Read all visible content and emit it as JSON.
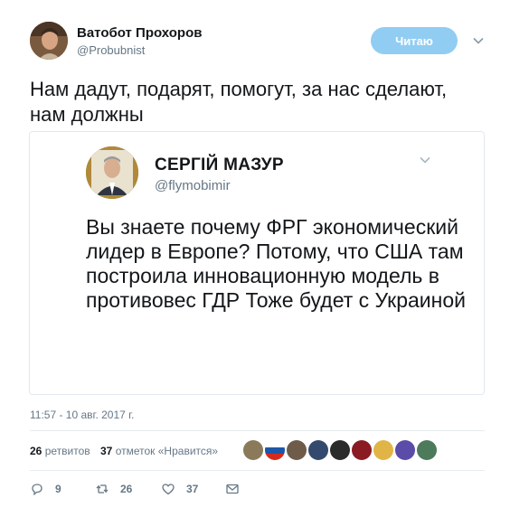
{
  "author": {
    "name": "Ватобот Прохоров",
    "handle": "@Probubnist"
  },
  "follow_button": "Читаю",
  "tweet_text": "Нам дадут, подарят, помогут, за нас сделают, нам должны",
  "quoted": {
    "name": "СЕРГІЙ  МАЗУР",
    "handle": "@flymobimir",
    "text": "Вы знаете почему ФРГ экономический лидер в Европе? Потому, что США там построила инновационную модель в противовес ГДР Тоже будет с Украиной"
  },
  "timestamp": "11:57 - 10 авг. 2017 г.",
  "stats": {
    "retweets_count": "26",
    "retweets_label": "ретвитов",
    "likes_count": "37",
    "likes_label": "отметок «Нравится»"
  },
  "actions": {
    "reply_count": "9",
    "retweet_count": "26",
    "like_count": "37"
  },
  "colors": {
    "accent": "#1da1f2",
    "follow_button_bg": "#91cdf2",
    "secondary_text": "#657786",
    "border": "#e1e8ed"
  },
  "icons": {
    "caret": "chevron-down-icon",
    "reply": "reply-icon",
    "retweet": "retweet-icon",
    "like": "heart-icon",
    "dm": "envelope-icon"
  }
}
